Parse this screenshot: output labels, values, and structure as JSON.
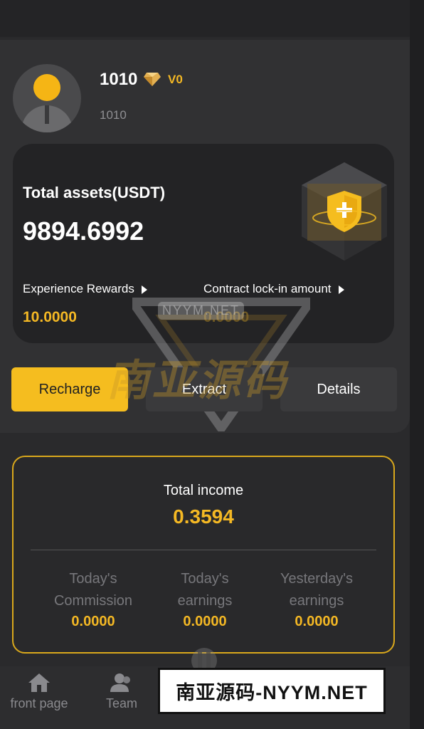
{
  "profile": {
    "username": "1010",
    "level": "V0",
    "user_id": "1010"
  },
  "assets": {
    "title": "Total assets(USDT)",
    "value": "9894.6992",
    "experience_label": "Experience Rewards",
    "experience_value": "10.0000",
    "lock_label": "Contract lock-in amount",
    "lock_value": "0.0000"
  },
  "actions": {
    "recharge": "Recharge",
    "extract": "Extract",
    "details": "Details"
  },
  "income": {
    "title": "Total income",
    "value": "0.3594",
    "stats": [
      {
        "label_1": "Today's",
        "label_2": "Commission",
        "value": "0.0000"
      },
      {
        "label_1": "Today's",
        "label_2": "earnings",
        "value": "0.0000"
      },
      {
        "label_1": "Yesterday's",
        "label_2": "earnings",
        "value": "0.0000"
      }
    ]
  },
  "nav": {
    "home": "front page",
    "team": "Team"
  },
  "watermark": {
    "small": "NYYM.NET",
    "large": "南亚源码",
    "banner": "南亚源码-NYYM.NET"
  },
  "colors": {
    "accent": "#f5bd1f",
    "background": "#2a2a2c",
    "card": "#232325"
  }
}
